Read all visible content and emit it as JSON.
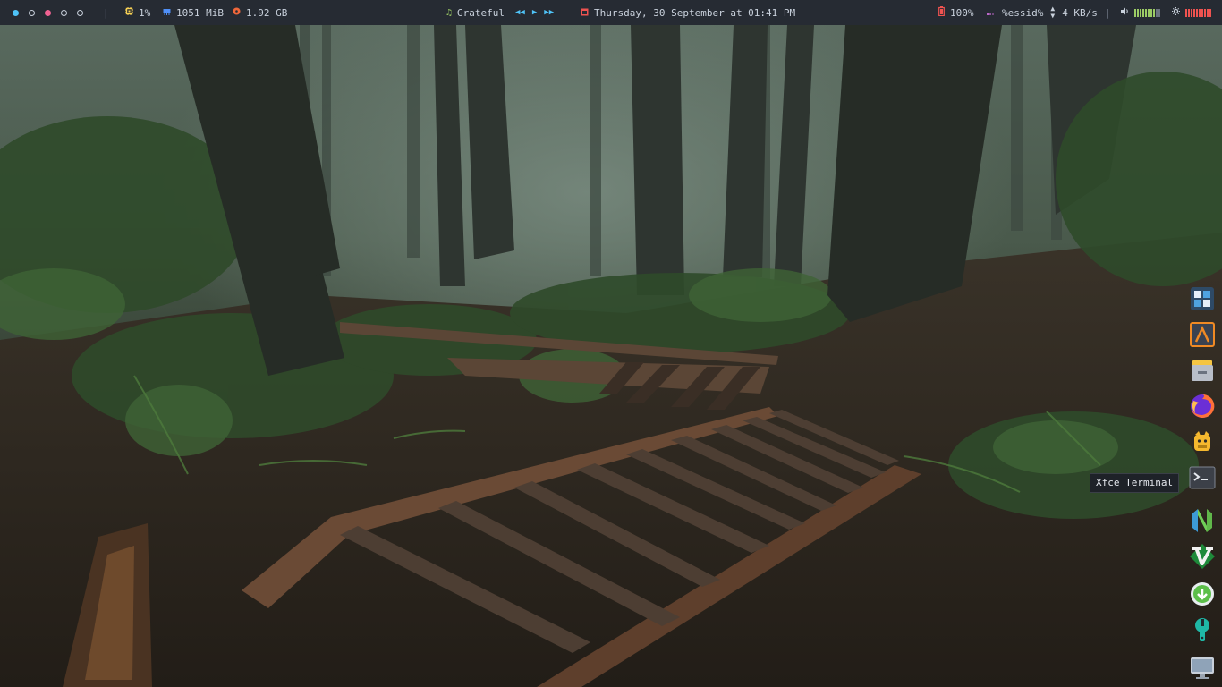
{
  "topbar": {
    "workspaces": [
      {
        "state": "active"
      },
      {
        "state": "empty"
      },
      {
        "state": "urgent"
      },
      {
        "state": "empty"
      },
      {
        "state": "empty"
      }
    ],
    "separator": "|",
    "cpu": {
      "icon": "cpu-icon",
      "value": "1%",
      "color": "#f7d154"
    },
    "memory": {
      "icon": "memory-icon",
      "value": "1051 MiB",
      "color": "#4f8ff7"
    },
    "disk": {
      "icon": "disk-icon",
      "value": "1.92 GB",
      "color": "#f0673a"
    },
    "music": {
      "icon": "music-note-icon",
      "title": "Grateful",
      "accent": "#9ccc65",
      "controls_color": "#4fc3f7"
    },
    "datetime": {
      "icon": "calendar-icon",
      "value": "Thursday, 30 September at 01:41 PM",
      "color": "#ef5350"
    },
    "battery": {
      "icon": "battery-icon",
      "value": "100%",
      "color": "#ef5350"
    },
    "network": {
      "icon": "wifi-icon",
      "essid": "%essid%",
      "speed": "4 KB/s",
      "color": "#ba68c8"
    },
    "volume": {
      "icon": "volume-icon",
      "level": 0.8,
      "color": "#9ccc65"
    },
    "brightness": {
      "icon": "brightness-icon",
      "level": 1.0,
      "color": "#ef5350"
    }
  },
  "dock": {
    "items": [
      {
        "name": "workspace-switcher",
        "icon": "workspace-grid-icon"
      },
      {
        "name": "text-editor",
        "icon": "lambda-icon"
      },
      {
        "name": "file-manager",
        "icon": "drawer-icon"
      },
      {
        "name": "firefox",
        "icon": "firefox-icon"
      },
      {
        "name": "kitty",
        "icon": "cat-icon"
      },
      {
        "name": "xfce-terminal",
        "icon": "terminal-icon"
      },
      {
        "name": "neovim",
        "icon": "neovim-icon"
      },
      {
        "name": "vim",
        "icon": "vim-icon"
      },
      {
        "name": "downloader",
        "icon": "download-icon"
      },
      {
        "name": "settings",
        "icon": "wrench-icon"
      },
      {
        "name": "display",
        "icon": "monitor-icon"
      }
    ],
    "tooltip": "Xfce Terminal"
  }
}
